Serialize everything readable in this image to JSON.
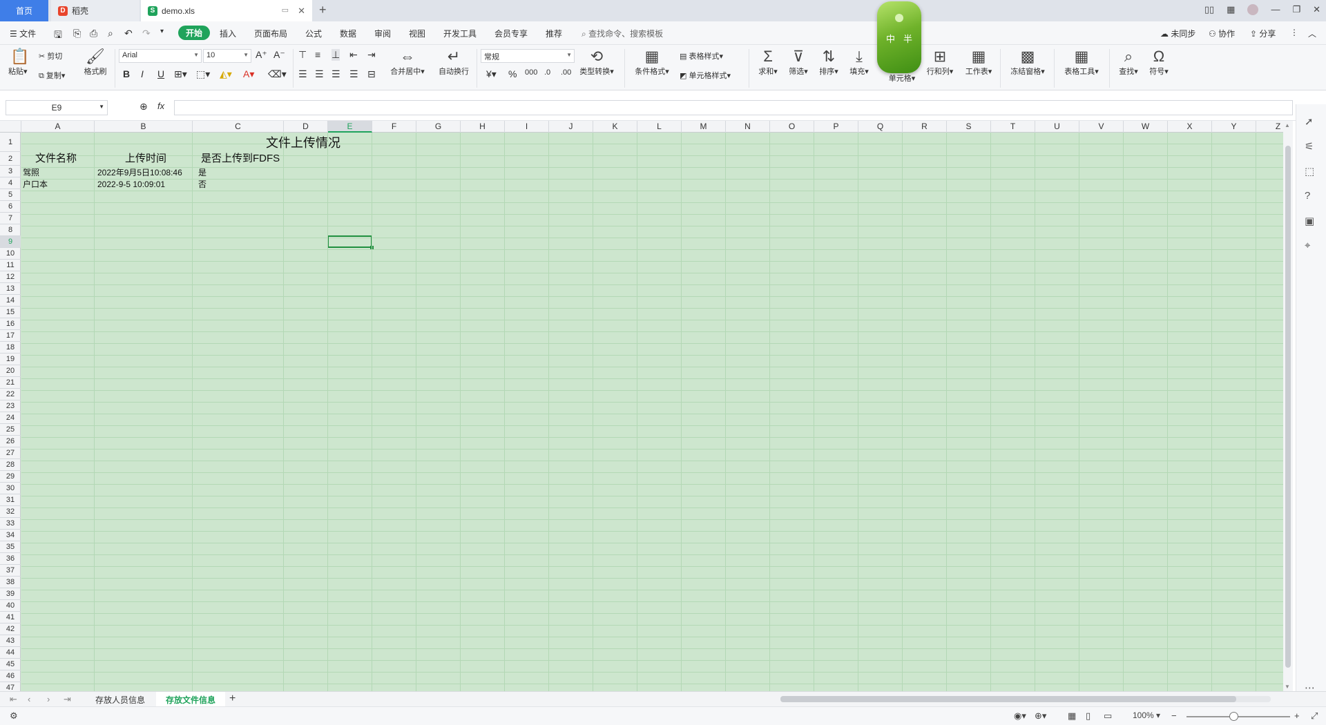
{
  "tabs": {
    "home": "首页",
    "daoke": "稻壳",
    "file": "demo.xls"
  },
  "menu": {
    "file": "文件",
    "items": [
      "开始",
      "插入",
      "页面布局",
      "公式",
      "数据",
      "审阅",
      "视图",
      "开发工具",
      "会员专享",
      "推荐"
    ],
    "search": "查找命令、搜索模板",
    "sync": "未同步",
    "collab": "协作",
    "share": "分享"
  },
  "ribbon": {
    "paste": "粘贴",
    "cut": "剪切",
    "copy": "复制",
    "format_painter": "格式刷",
    "font_name": "Arial",
    "font_size": "10",
    "merge_center": "合并居中",
    "wrap_text": "自动换行",
    "number_format": "常规",
    "type_convert": "类型转换",
    "cond_format": "条件格式",
    "table_style": "表格样式",
    "cell_style": "单元格样式",
    "sum": "求和",
    "filter": "筛选",
    "sort": "排序",
    "fill": "填充",
    "cell": "单元格",
    "row_col": "行和列",
    "worksheet": "工作表",
    "freeze": "冻结窗格",
    "table_tools": "表格工具",
    "find": "查找",
    "symbol": "符号"
  },
  "formula_bar": {
    "name_box": "E9",
    "fx": "fx",
    "content": ""
  },
  "columns": [
    "A",
    "B",
    "C",
    "D",
    "E",
    "F",
    "G",
    "H",
    "I",
    "J",
    "K",
    "L",
    "M",
    "N",
    "O",
    "P",
    "Q",
    "R",
    "S",
    "T",
    "U",
    "V",
    "W",
    "X",
    "Y",
    "Z"
  ],
  "selected_cell": "E9",
  "sheet_cells": {
    "title": "文件上传情况",
    "header_a": "文件名称",
    "header_b": "上传时间",
    "header_c": "是否上传到FDFS",
    "r3_a": "驾照",
    "r3_b": "2022年9月5日10:08:46",
    "r3_c": "是",
    "r4_a": "户口本",
    "r4_b": "2022-9-5 10:09:01",
    "r4_c": "否"
  },
  "sheets": [
    "存放人员信息",
    "存放文件信息"
  ],
  "active_sheet": "存放文件信息",
  "status": {
    "zoom": "100%"
  },
  "widget": {
    "char1": "中",
    "char2": "半"
  },
  "colors": {
    "accent": "#1fa35b",
    "grid_bg": "#cde6ce",
    "home_tab": "#3f7ee8"
  }
}
